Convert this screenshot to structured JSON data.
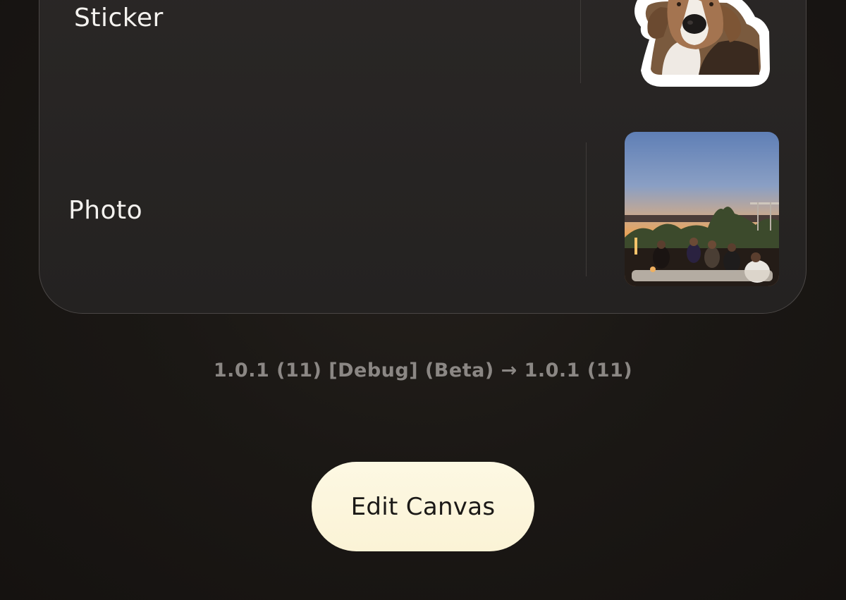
{
  "widgets": {
    "sticker": {
      "label": "Sticker",
      "icon": "dog-sticker-icon"
    },
    "photo": {
      "label": "Photo",
      "icon": "rooftop-sunset-photo"
    }
  },
  "footer": {
    "version_text": "1.0.1 (11) [Debug] (Beta) → 1.0.1 (11)"
  },
  "actions": {
    "edit_canvas_label": "Edit Canvas"
  },
  "colors": {
    "background": "#1a1714",
    "card": "#262322",
    "button": "#fcf5dc",
    "version_text": "#8b8784"
  }
}
